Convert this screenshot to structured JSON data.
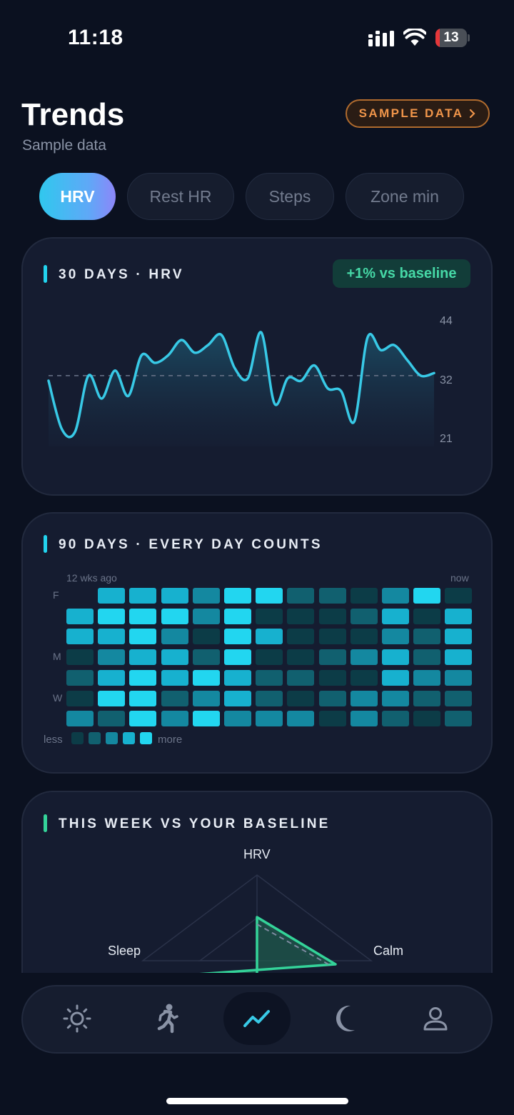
{
  "status_bar": {
    "time": "11:18",
    "battery": 13
  },
  "header": {
    "title": "Trends",
    "subtitle": "Sample data",
    "sample_button_label": "SAMPLE DATA"
  },
  "tabs": [
    {
      "label": "HRV",
      "active": true
    },
    {
      "label": "Rest HR",
      "active": false
    },
    {
      "label": "Steps",
      "active": false
    },
    {
      "label": "Zone min",
      "active": false
    }
  ],
  "trend_card": {
    "title": "30 DAYS · HRV",
    "badge": "+1% vs baseline",
    "accent_color": "#22d3ee",
    "badge_color": "#46d8a6"
  },
  "chart_data": {
    "type": "line",
    "x": [
      1,
      2,
      3,
      4,
      5,
      6,
      7,
      8,
      9,
      10,
      11,
      12,
      13,
      14,
      15,
      16,
      17,
      18,
      19,
      20,
      21,
      22,
      23,
      24,
      25,
      26,
      27,
      28,
      29,
      30
    ],
    "series": [
      {
        "values": [
          32.5,
          23.0,
          22.5,
          33.5,
          29.0,
          34.5,
          29.5,
          37.5,
          36.0,
          37.5,
          40.5,
          38.0,
          39.5,
          41.5,
          35.0,
          33.0,
          42.0,
          28.0,
          33.0,
          32.5,
          35.5,
          31.0,
          30.5,
          24.5,
          41.0,
          38.5,
          39.5,
          36.5,
          33.5,
          34.0
        ]
      }
    ],
    "baseline": 33.5,
    "y_ticks": [
      44,
      32,
      21
    ],
    "ylim": [
      21,
      44
    ],
    "grid": false,
    "line_color": "#38c9e6"
  },
  "heatmap_card": {
    "title": "90 DAYS · EVERY DAY COUNTS",
    "accent_color": "#22d3ee",
    "left_label": "12 wks ago",
    "right_label": "now",
    "row_labels": [
      "F",
      "",
      "",
      "M",
      "",
      "W",
      ""
    ],
    "legend_less": "less",
    "legend_more": "more",
    "levels_colors": [
      "#0c3c47",
      "#11606f",
      "#1488a0",
      "#17b1cf",
      "#22d6f0"
    ],
    "grid": [
      [
        -1,
        3,
        3,
        3,
        2,
        4,
        4,
        1,
        1,
        0,
        2,
        4,
        0
      ],
      [
        3,
        4,
        4,
        4,
        2,
        4,
        0,
        0,
        0,
        1,
        3,
        0,
        3
      ],
      [
        3,
        3,
        4,
        2,
        0,
        4,
        3,
        0,
        0,
        0,
        2,
        1,
        3
      ],
      [
        0,
        2,
        3,
        3,
        1,
        4,
        0,
        0,
        1,
        2,
        3,
        1,
        3
      ],
      [
        1,
        3,
        4,
        3,
        4,
        3,
        1,
        1,
        0,
        0,
        3,
        2,
        2
      ],
      [
        0,
        4,
        4,
        1,
        2,
        3,
        1,
        0,
        1,
        2,
        2,
        1,
        1
      ],
      [
        2,
        1,
        4,
        2,
        4,
        2,
        2,
        2,
        0,
        2,
        1,
        0,
        1
      ]
    ]
  },
  "radar_card": {
    "title": "THIS WEEK VS YOUR BASELINE",
    "accent_color": "#34d399",
    "axes": [
      "HRV",
      "Calm",
      "Sleep"
    ],
    "this_week_color": "#34d399"
  },
  "bottom_nav": [
    {
      "icon": "sun-icon",
      "active": false
    },
    {
      "icon": "runner-icon",
      "active": false
    },
    {
      "icon": "trend-icon",
      "active": true
    },
    {
      "icon": "moon-icon",
      "active": false
    },
    {
      "icon": "profile-icon",
      "active": false
    }
  ]
}
